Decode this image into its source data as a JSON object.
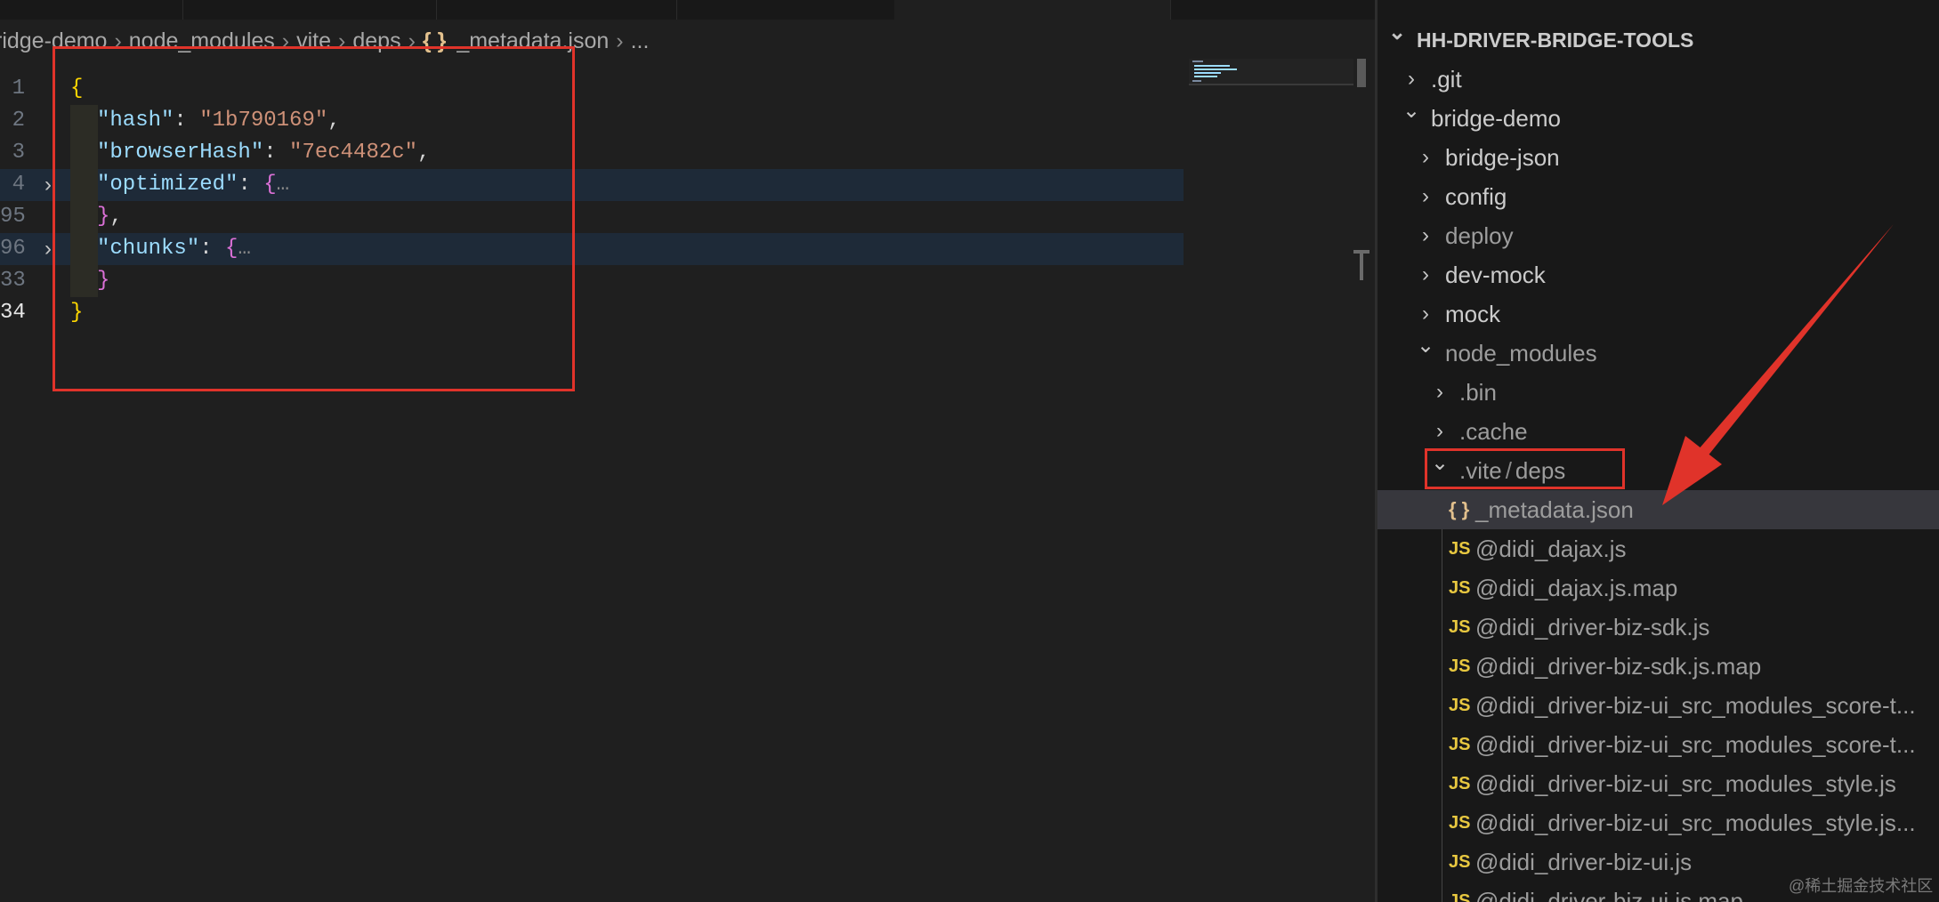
{
  "breadcrumb": [
    "ridge-demo",
    "node_modules",
    "vite",
    "deps",
    "_metadata.json",
    "..."
  ],
  "breadcrumb_file_icon": "json-braces-icon",
  "editor": {
    "lines": [
      {
        "num": "1",
        "tokens": [
          {
            "c": "b1",
            "t": "{"
          }
        ]
      },
      {
        "num": "2",
        "tokens": [
          {
            "c": "k",
            "t": "\"hash\""
          },
          {
            "c": "p",
            "t": ": "
          },
          {
            "c": "s",
            "t": "\"1b790169\""
          },
          {
            "c": "p",
            "t": ","
          }
        ]
      },
      {
        "num": "3",
        "tokens": [
          {
            "c": "k",
            "t": "\"browserHash\""
          },
          {
            "c": "p",
            "t": ": "
          },
          {
            "c": "s",
            "t": "\"7ec4482c\""
          },
          {
            "c": "p",
            "t": ","
          }
        ]
      },
      {
        "num": "4",
        "fold": true,
        "hl": true,
        "tokens": [
          {
            "c": "k",
            "t": "\"optimized\""
          },
          {
            "c": "p",
            "t": ": "
          },
          {
            "c": "b2",
            "t": "{"
          },
          {
            "c": "dots",
            "t": "…"
          }
        ]
      },
      {
        "num": "95",
        "tokens": [
          {
            "c": "b2",
            "t": "}"
          },
          {
            "c": "p",
            "t": ","
          }
        ]
      },
      {
        "num": "96",
        "fold": true,
        "hl": true,
        "tokens": [
          {
            "c": "k",
            "t": "\"chunks\""
          },
          {
            "c": "p",
            "t": ": "
          },
          {
            "c": "b2",
            "t": "{"
          },
          {
            "c": "dots",
            "t": "…"
          }
        ]
      },
      {
        "num": "33",
        "tokens": [
          {
            "c": "b2",
            "t": "}"
          }
        ]
      },
      {
        "num": "34",
        "current": true,
        "tokens": [
          {
            "c": "b1",
            "t": "}"
          }
        ]
      }
    ]
  },
  "explorer": {
    "items": [
      {
        "label": "HH-DRIVER-BRIDGE-TOOLS",
        "chevron": "open",
        "root": true
      },
      {
        "label": ".git",
        "chevron": "closed",
        "depth": 1
      },
      {
        "label": "bridge-demo",
        "chevron": "open",
        "depth": 1
      },
      {
        "label": "bridge-json",
        "chevron": "closed",
        "depth": 2
      },
      {
        "label": "config",
        "chevron": "closed",
        "depth": 2
      },
      {
        "label": "deploy",
        "chevron": "closed",
        "depth": 2,
        "dim": true
      },
      {
        "label": "dev-mock",
        "chevron": "closed",
        "depth": 2
      },
      {
        "label": "mock",
        "chevron": "closed",
        "depth": 2
      },
      {
        "label": "node_modules",
        "chevron": "open",
        "depth": 2,
        "dim": true
      },
      {
        "label": ".bin",
        "chevron": "closed",
        "depth": 3,
        "dim": true
      },
      {
        "label": ".cache",
        "chevron": "closed",
        "depth": 3,
        "dim": true
      },
      {
        "label": ".vite",
        "label2": "deps",
        "chevron": "open",
        "depth": 3,
        "dim": true
      },
      {
        "label": "_metadata.json",
        "icon": "json",
        "depth": 4,
        "selected": true,
        "dim": true
      },
      {
        "label": "@didi_dajax.js",
        "icon": "js",
        "depth": 4,
        "dim": true
      },
      {
        "label": "@didi_dajax.js.map",
        "icon": "js",
        "depth": 4,
        "dim": true
      },
      {
        "label": "@didi_driver-biz-sdk.js",
        "icon": "js",
        "depth": 4,
        "dim": true
      },
      {
        "label": "@didi_driver-biz-sdk.js.map",
        "icon": "js",
        "depth": 4,
        "dim": true
      },
      {
        "label": "@didi_driver-biz-ui_src_modules_score-t...",
        "icon": "js",
        "depth": 4,
        "dim": true
      },
      {
        "label": "@didi_driver-biz-ui_src_modules_score-t...",
        "icon": "js",
        "depth": 4,
        "dim": true
      },
      {
        "label": "@didi_driver-biz-ui_src_modules_style.js",
        "icon": "js",
        "depth": 4,
        "dim": true
      },
      {
        "label": "@didi_driver-biz-ui_src_modules_style.js...",
        "icon": "js",
        "depth": 4,
        "dim": true
      },
      {
        "label": "@didi_driver-biz-ui.js",
        "icon": "js",
        "depth": 4,
        "dim": true
      },
      {
        "label": "@didi_driver-biz-ui.js.map",
        "icon": "js",
        "depth": 4,
        "dim": true
      }
    ],
    "js_icon_text": "JS",
    "json_icon_text": "{ }"
  },
  "watermark": "@稀土掘金技术社区",
  "colors": {
    "accent_annotation": "#e0332a",
    "key": "#9cdcfe",
    "string": "#ce9178"
  }
}
